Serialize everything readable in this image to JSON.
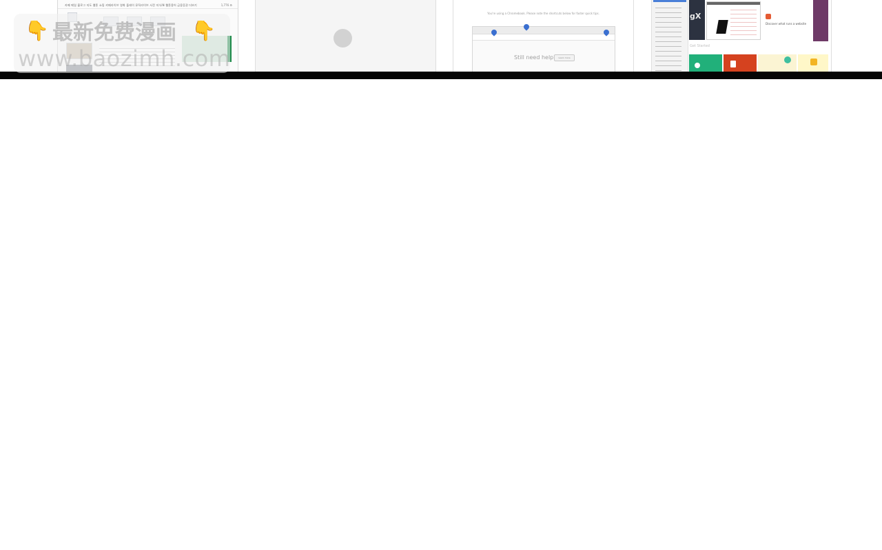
{
  "thumbnails": {
    "first": {
      "menu_text": "카페 메일 블로그 지도 웹툰 쇼핑 카페라이브 영화 플레이 뮤직라이브 사전 지식iN 웹툰용어 금융증권 더보기",
      "menu_right": "1,776 ⚙"
    },
    "second": {},
    "third": {
      "caption": "You're using a Chromebook. Please note the shortcuts below for faster quick tips.",
      "help_text": "Still need help?",
      "help_button": "Learn more"
    },
    "fourth": {
      "panel_letters": "gX",
      "site_text": "Discover what runs a website",
      "under_label": "Get Started"
    }
  },
  "watermark": {
    "hand_left": "👇",
    "title": "最新免费漫画",
    "hand_right": "👇",
    "url": "www.baozimh.com"
  },
  "colors": {
    "accent_green": "#1e8a4a",
    "pin_blue": "#3a6fd0",
    "tile_green": "#21b07a",
    "tile_orange": "#d5421f",
    "panel_purple": "#6e3a67"
  }
}
